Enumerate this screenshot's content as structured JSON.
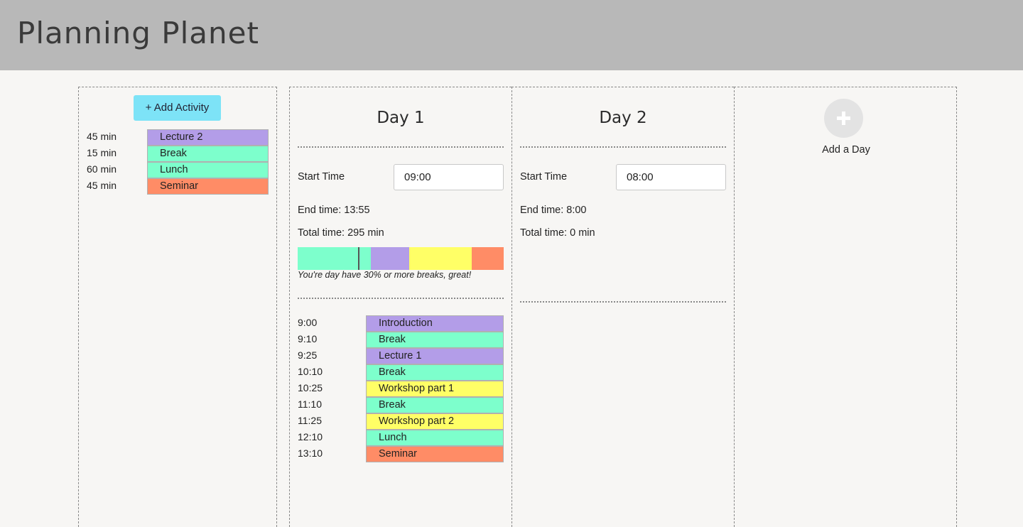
{
  "app": {
    "title": "Planning Planet"
  },
  "colors": {
    "header_bg": "#b8b8b8",
    "lecture": "#b39de8",
    "break": "#7dffcc",
    "seminar": "#ff8c66",
    "workshop": "#ffff66",
    "add_button": "#7de3f7"
  },
  "pool": {
    "add_label": "+ Add Activity",
    "items": [
      {
        "duration": "45 min",
        "name": "Lecture 2",
        "kind": "lecture"
      },
      {
        "duration": "15 min",
        "name": "Break",
        "kind": "break"
      },
      {
        "duration": "60 min",
        "name": "Lunch",
        "kind": "break"
      },
      {
        "duration": "45 min",
        "name": "Seminar",
        "kind": "seminar"
      }
    ]
  },
  "days": [
    {
      "title": "Day 1",
      "start_label": "Start Time",
      "start_value": "09:00",
      "end_text": "End time: 13:55",
      "total_text": "Total time: 295 min",
      "note": "You're day have 30% or more breaks, great!",
      "bar": [
        {
          "kind": "break",
          "fraction": 0.355
        },
        {
          "kind": "lecture",
          "fraction": 0.186
        },
        {
          "kind": "workshop",
          "fraction": 0.303
        },
        {
          "kind": "seminar",
          "fraction": 0.156
        }
      ],
      "schedule": [
        {
          "time": "9:00",
          "name": "Introduction",
          "kind": "lecture"
        },
        {
          "time": "9:10",
          "name": "Break",
          "kind": "break"
        },
        {
          "time": "9:25",
          "name": "Lecture 1",
          "kind": "lecture"
        },
        {
          "time": "10:10",
          "name": "Break",
          "kind": "break"
        },
        {
          "time": "10:25",
          "name": "Workshop part 1",
          "kind": "workshop"
        },
        {
          "time": "11:10",
          "name": "Break",
          "kind": "break"
        },
        {
          "time": "11:25",
          "name": "Workshop part 2",
          "kind": "workshop"
        },
        {
          "time": "12:10",
          "name": "Lunch",
          "kind": "break"
        },
        {
          "time": "13:10",
          "name": "Seminar",
          "kind": "seminar"
        }
      ]
    },
    {
      "title": "Day 2",
      "start_label": "Start Time",
      "start_value": "08:00",
      "end_text": "End time: 8:00",
      "total_text": "Total time: 0 min"
    }
  ],
  "add_day": {
    "label": "Add a Day",
    "icon": "plus-icon"
  }
}
